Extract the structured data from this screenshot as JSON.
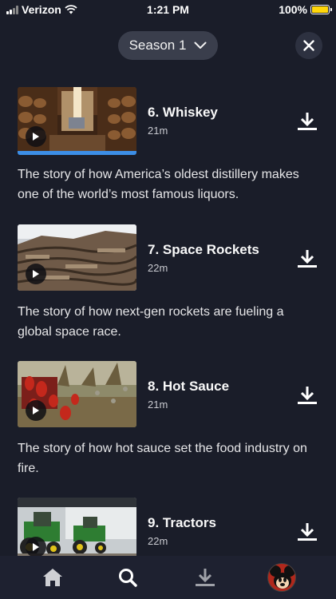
{
  "status_bar": {
    "carrier": "Verizon",
    "time": "1:21 PM",
    "battery": "100%"
  },
  "header": {
    "season_label": "Season 1",
    "season_dropdown_icon": "chevron-down-icon",
    "close_icon": "close-icon"
  },
  "episodes": [
    {
      "title": "6. Whiskey",
      "duration": "21m",
      "description": "The story of how America’s oldest distillery makes one of the world’s most famous liquors.",
      "progress": 1.0
    },
    {
      "title": "7. Space Rockets",
      "duration": "22m",
      "description": "The story of how next-gen rockets are fueling a global space race."
    },
    {
      "title": "8. Hot Sauce",
      "duration": "21m",
      "description": "The story of how hot sauce set the food industry on fire."
    },
    {
      "title": "9. Tractors",
      "duration": "22m",
      "description": ""
    }
  ],
  "tab_bar": {
    "items": [
      "home-icon",
      "search-icon",
      "downloads-icon",
      "profile-avatar"
    ],
    "active": "search-icon"
  },
  "colors": {
    "background": "#1a1d29",
    "pill": "#3a3e4c",
    "progress": "#3c8ee6",
    "tab_bar": "#1e2130"
  }
}
